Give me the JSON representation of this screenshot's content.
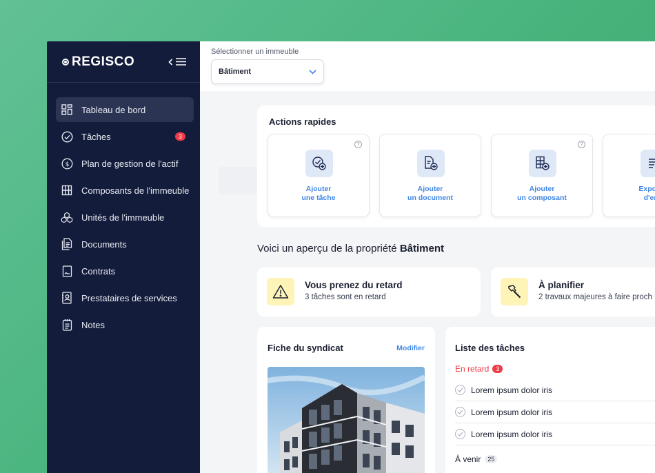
{
  "app": {
    "logo": "REGISCO"
  },
  "sidebar": {
    "items": [
      {
        "label": "Tableau de bord",
        "icon": "dashboard-icon",
        "active": true
      },
      {
        "label": "Tâches",
        "icon": "check-circle-icon",
        "badge": "3"
      },
      {
        "label": "Plan de gestion de l'actif",
        "icon": "dollar-circle-icon"
      },
      {
        "label": "Composants de l'immeuble",
        "icon": "building-grid-icon"
      },
      {
        "label": "Unités de l'immeuble",
        "icon": "cubes-icon"
      },
      {
        "label": "Documents",
        "icon": "documents-icon"
      },
      {
        "label": "Contrats",
        "icon": "contract-icon"
      },
      {
        "label": "Prestataires de services",
        "icon": "contacts-book-icon"
      },
      {
        "label": "Notes",
        "icon": "notes-icon"
      }
    ]
  },
  "topbar": {
    "select_label": "Sélectionner un immeuble",
    "select_value": "Bâtiment"
  },
  "quick_actions": {
    "title": "Actions rapides",
    "items": [
      {
        "label": "Ajouter\nune tâche",
        "icon": "add-task-icon",
        "help": true
      },
      {
        "label": "Ajouter\nun document",
        "icon": "add-document-icon",
        "help": false
      },
      {
        "label": "Ajouter\nun composant",
        "icon": "add-component-icon",
        "help": true
      },
      {
        "label": "Exporter\nd'entr",
        "icon": "export-icon",
        "help": false
      }
    ]
  },
  "intro": {
    "prefix": "Voici un aperçu de la propriété ",
    "property": "Bâtiment"
  },
  "alerts": [
    {
      "title": "Vous prenez du retard",
      "subtitle": "3 tâches sont en retard",
      "icon": "warning-icon"
    },
    {
      "title": "À planifier",
      "subtitle": "2 travaux majeures à faire proch",
      "icon": "hammer-icon"
    }
  ],
  "syndicate": {
    "title": "Fiche du syndicat",
    "edit": "Modifier"
  },
  "tasks": {
    "title": "Liste des tâches",
    "late_label": "En retard",
    "late_count": "3",
    "items": [
      "Lorem ipsum dolor iris",
      "Lorem ipsum dolor iris",
      "Lorem ipsum dolor iris"
    ],
    "upcoming_label": "À venir",
    "upcoming_count": "25"
  },
  "colors": {
    "sidebar": "#131c3b",
    "accent": "#3f86e6",
    "danger": "#ef3b47",
    "alert_bg": "#fff4b8"
  }
}
